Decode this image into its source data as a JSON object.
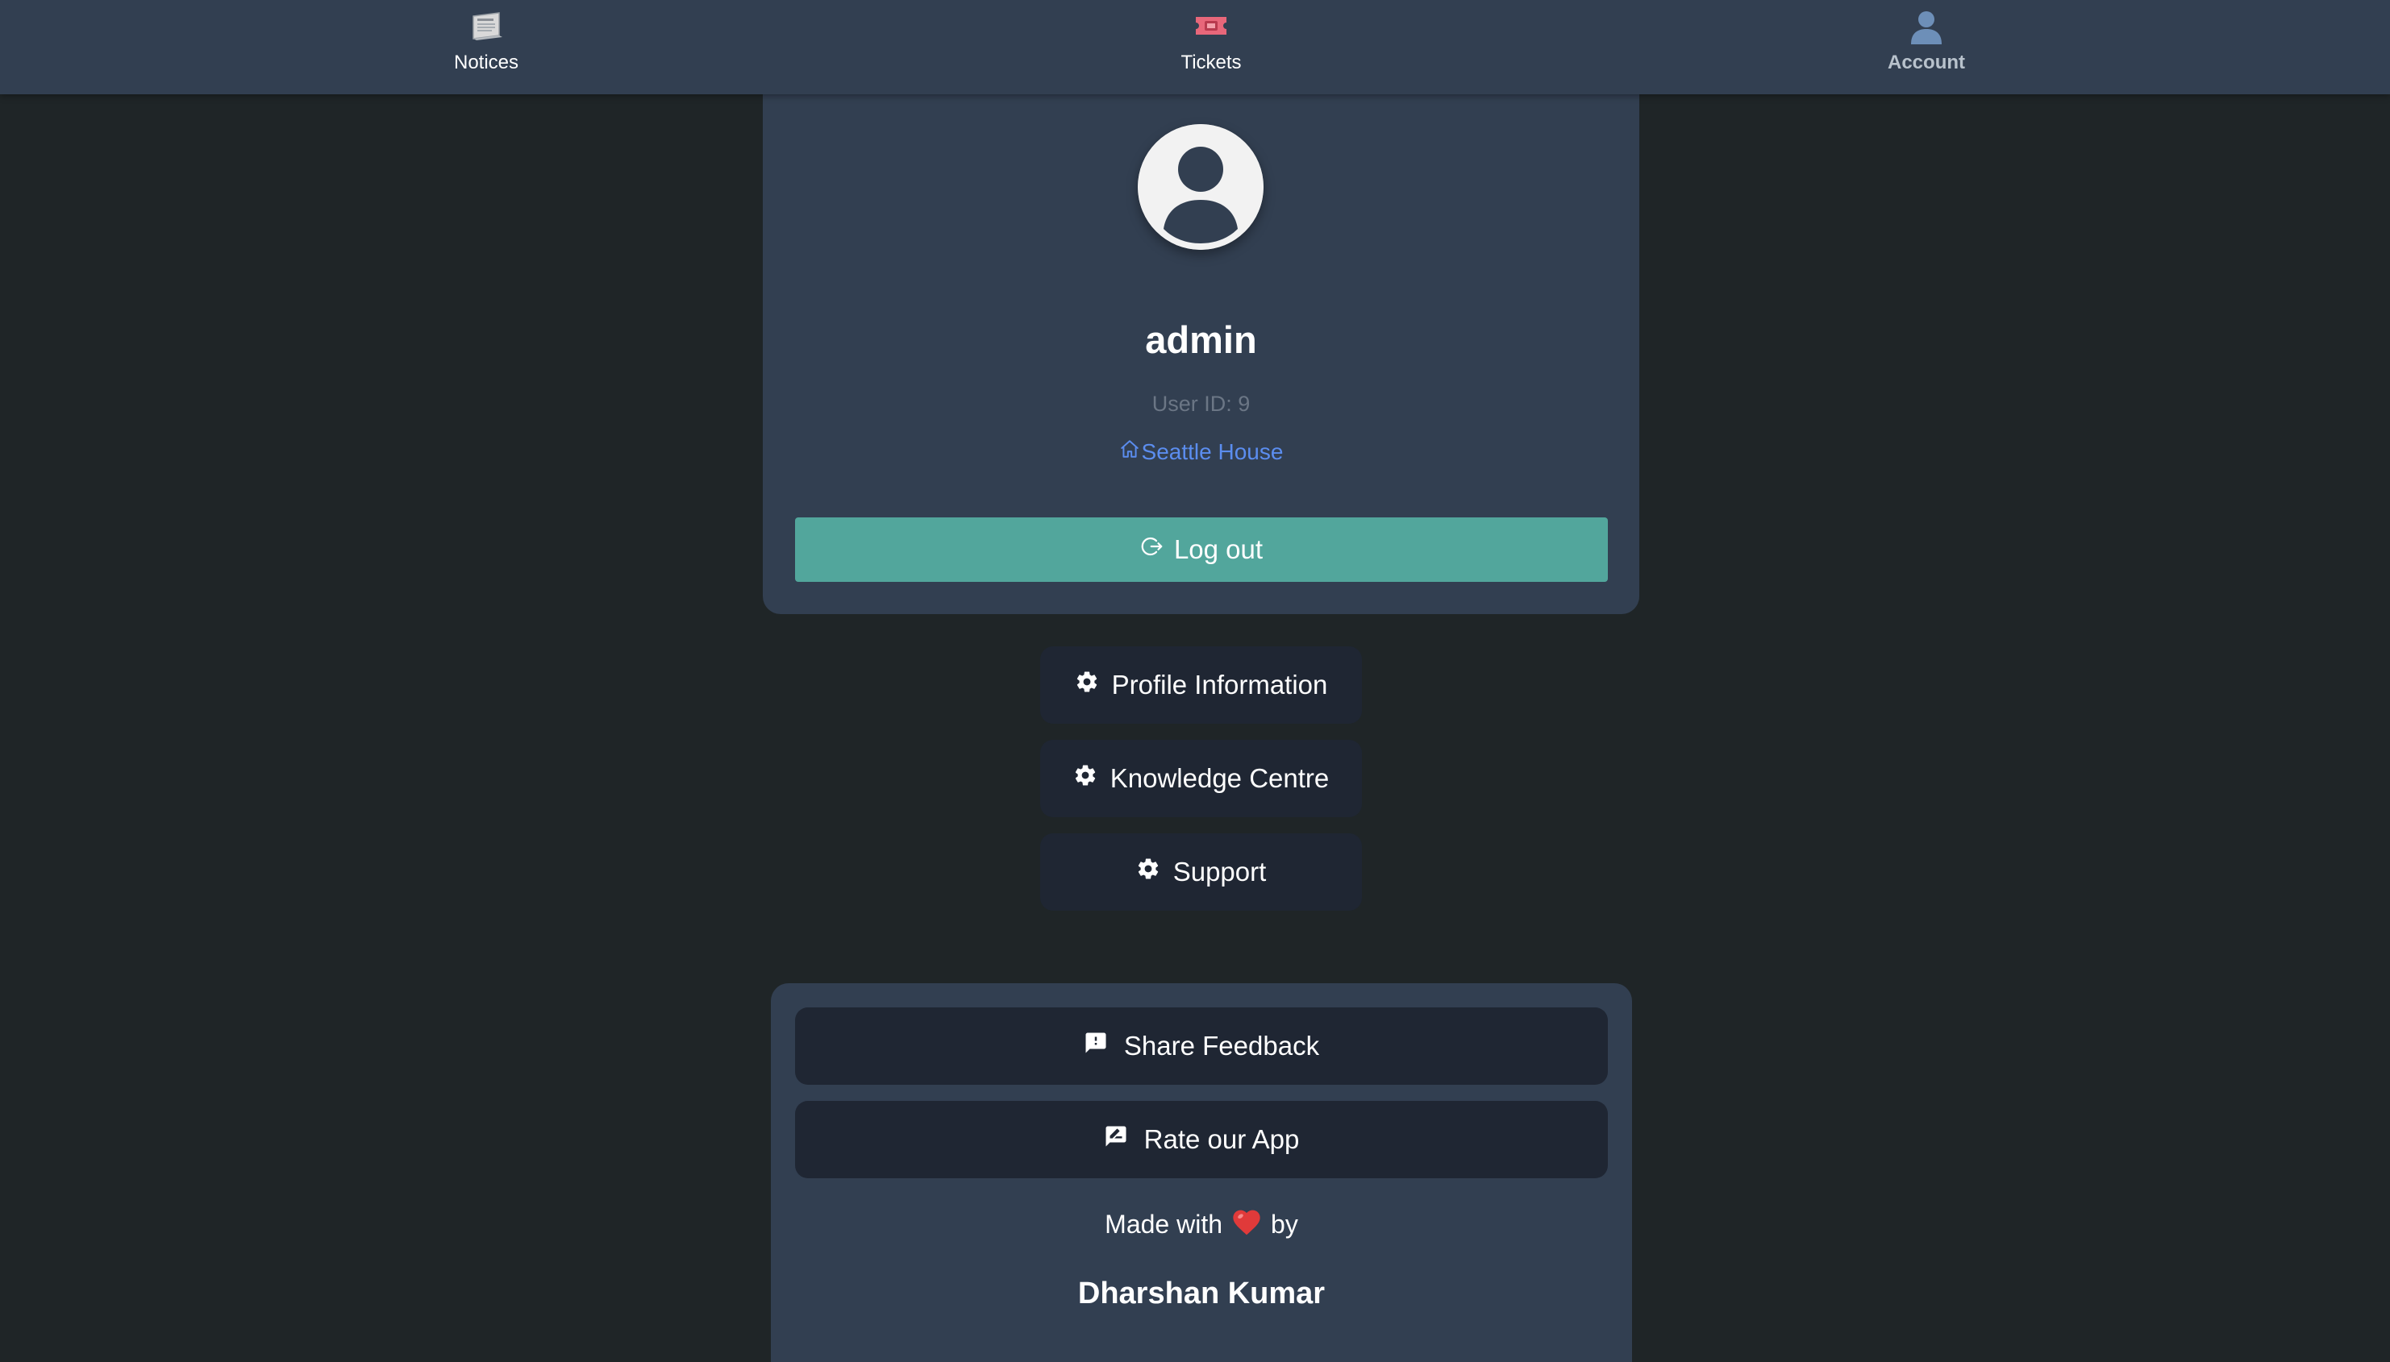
{
  "nav": {
    "items": [
      {
        "label": "Notices",
        "icon": "newspaper-icon"
      },
      {
        "label": "Tickets",
        "icon": "ticket-icon"
      },
      {
        "label": "Account",
        "icon": "user-silhouette-icon",
        "active": true
      }
    ]
  },
  "profile": {
    "avatar_icon": "user-avatar-icon",
    "name": "admin",
    "user_id": "User ID: 9",
    "house": "Seattle House",
    "house_icon": "home-icon",
    "logout_label": "Log out",
    "logout_icon": "logout-icon"
  },
  "menu": {
    "items": [
      {
        "label": "Profile Information",
        "icon": "gear-icon"
      },
      {
        "label": "Knowledge Centre",
        "icon": "gear-icon"
      },
      {
        "label": "Support",
        "icon": "gear-icon"
      }
    ]
  },
  "footer": {
    "feedback_label": "Share Feedback",
    "feedback_icon": "feedback-icon",
    "rate_label": "Rate our App",
    "rate_icon": "rate-review-icon",
    "made_with_prefix": "Made with",
    "made_with_suffix": "by",
    "heart_icon": "heart-icon",
    "author": "Dharshan Kumar"
  },
  "colors": {
    "page_bg": "#1f2527",
    "card_bg": "#323f51",
    "button_bg": "#1f2633",
    "logout_bg": "#52a69c",
    "link": "#5b8def",
    "muted": "#6b7685"
  }
}
